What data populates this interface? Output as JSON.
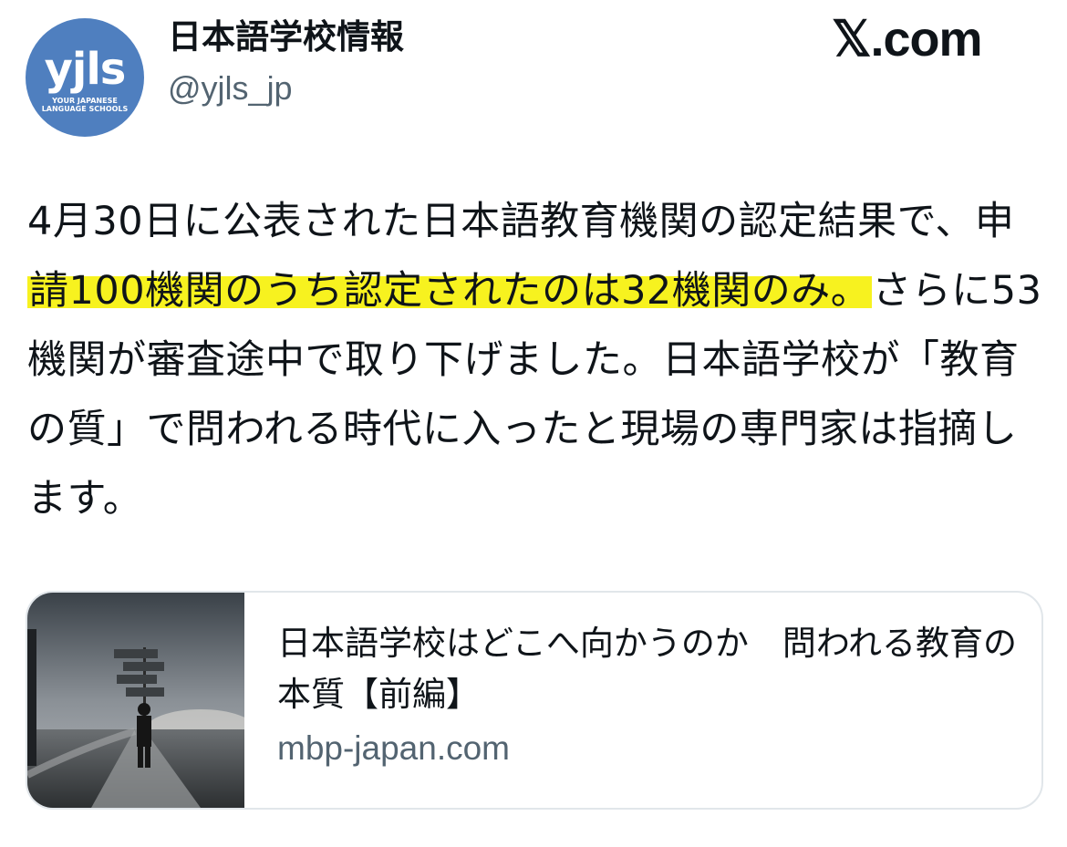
{
  "header": {
    "avatar_logo": "yjls",
    "avatar_subtext_line1": "YOUR JAPANESE",
    "avatar_subtext_line2": "LANGUAGE SCHOOLS",
    "display_name": "日本語学校情報",
    "handle": "@yjls_jp",
    "site_logo": "𝕏.com"
  },
  "tweet": {
    "seg1": "4月30日に公表された日本語教育機関の認定結果で、申",
    "seg2_highlight": "請100機関のうち認定されたのは32機関のみ。",
    "seg3": "さらに53機関が審査途中で取り下げました。日本語学校が「教育の質」で問われる時代に入ったと現場の専門家は指摘します。",
    "highlight_color": "#f7f21f"
  },
  "link_card": {
    "thumbnail_icon": "road-signpost-image",
    "title": "日本語学校はどこへ向かうのか　問われる教育の本質【前編】",
    "domain": "mbp-japan.com"
  }
}
